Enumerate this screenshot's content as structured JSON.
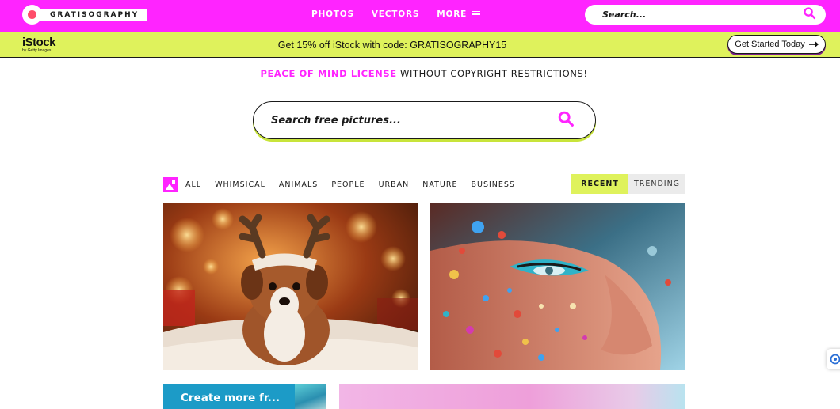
{
  "header": {
    "logo_text": "GRATISOGRAPHY",
    "nav": [
      {
        "label": "PHOTOS"
      },
      {
        "label": "VECTORS"
      },
      {
        "label": "MORE"
      }
    ],
    "search_placeholder": "Search..."
  },
  "istock_bar": {
    "brand": "iStock",
    "brand_sub": "by Getty Images",
    "promo_text": "Get 15% off iStock with code: GRATISOGRAPHY15",
    "cta_label": "Get Started Today"
  },
  "tagline": {
    "highlight": "PEACE OF MIND LICENSE",
    "rest": "WITHOUT COPYRIGHT RESTRICTIONS!"
  },
  "main_search": {
    "placeholder": "Search free pictures..."
  },
  "categories": [
    {
      "label": "ALL"
    },
    {
      "label": "WHIMSICAL"
    },
    {
      "label": "ANIMALS"
    },
    {
      "label": "PEOPLE"
    },
    {
      "label": "URBAN"
    },
    {
      "label": "NATURE"
    },
    {
      "label": "BUSINESS"
    }
  ],
  "sort": {
    "recent": "RECENT",
    "trending": "TRENDING",
    "active": "RECENT"
  },
  "promo_card": {
    "title": "Create more fr..."
  },
  "colors": {
    "brand_magenta": "#ff24ff",
    "istock_lime": "#dff25c",
    "text_dark": "#1a1a1a"
  },
  "icons": {
    "menu": "hamburger-icon",
    "search": "magnifier-icon",
    "arrow": "arrow-right-icon",
    "category": "image-icon"
  }
}
